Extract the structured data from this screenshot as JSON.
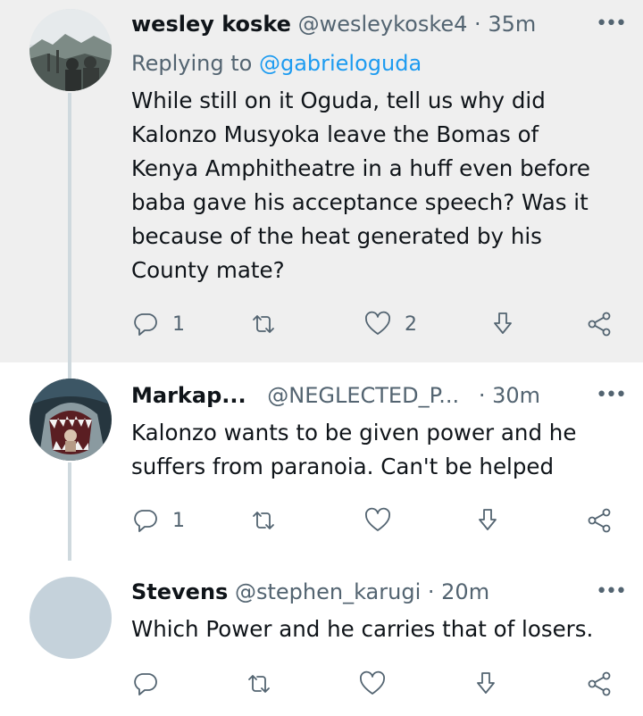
{
  "tweets": [
    {
      "name": "wesley koske",
      "handle": "@wesleykoske4",
      "time": "35m",
      "replying_prefix": "Replying to",
      "replying_to": "@gabrieloguda",
      "lines": [
        "While still on it Oguda, tell us why did",
        "Kalonzo Musyoka leave the Bomas of",
        "Kenya Amphitheatre in a huff even before",
        "baba gave his acceptance speech? Was it",
        "because of the heat generated by his",
        "County mate?"
      ],
      "reply_count": "1",
      "retweet_count": "",
      "like_count": "2"
    },
    {
      "name": "Markap...",
      "handle": "@NEGLECTED_P...",
      "time": "30m",
      "lines": [
        "Kalonzo wants to be given power and he",
        "suffers from paranoia. Can't be helped"
      ],
      "reply_count": "1",
      "retweet_count": "",
      "like_count": ""
    },
    {
      "name": "Stevens",
      "handle": "@stephen_karugi",
      "time": "20m",
      "lines": [
        "Which Power and he carries that of losers."
      ],
      "reply_count": "",
      "retweet_count": "",
      "like_count": ""
    }
  ],
  "separator": "·",
  "more_label": "•••",
  "colors": {
    "text": "#0f1419",
    "secondary": "#536471",
    "link": "#1d9bf0",
    "highlight_bg": "#efefef",
    "thread_line": "#cfd9de",
    "placeholder_avatar": "#c5d2db"
  },
  "icons": [
    "reply-icon",
    "retweet-icon",
    "like-icon",
    "bookmark-icon",
    "share-icon",
    "more-icon"
  ]
}
